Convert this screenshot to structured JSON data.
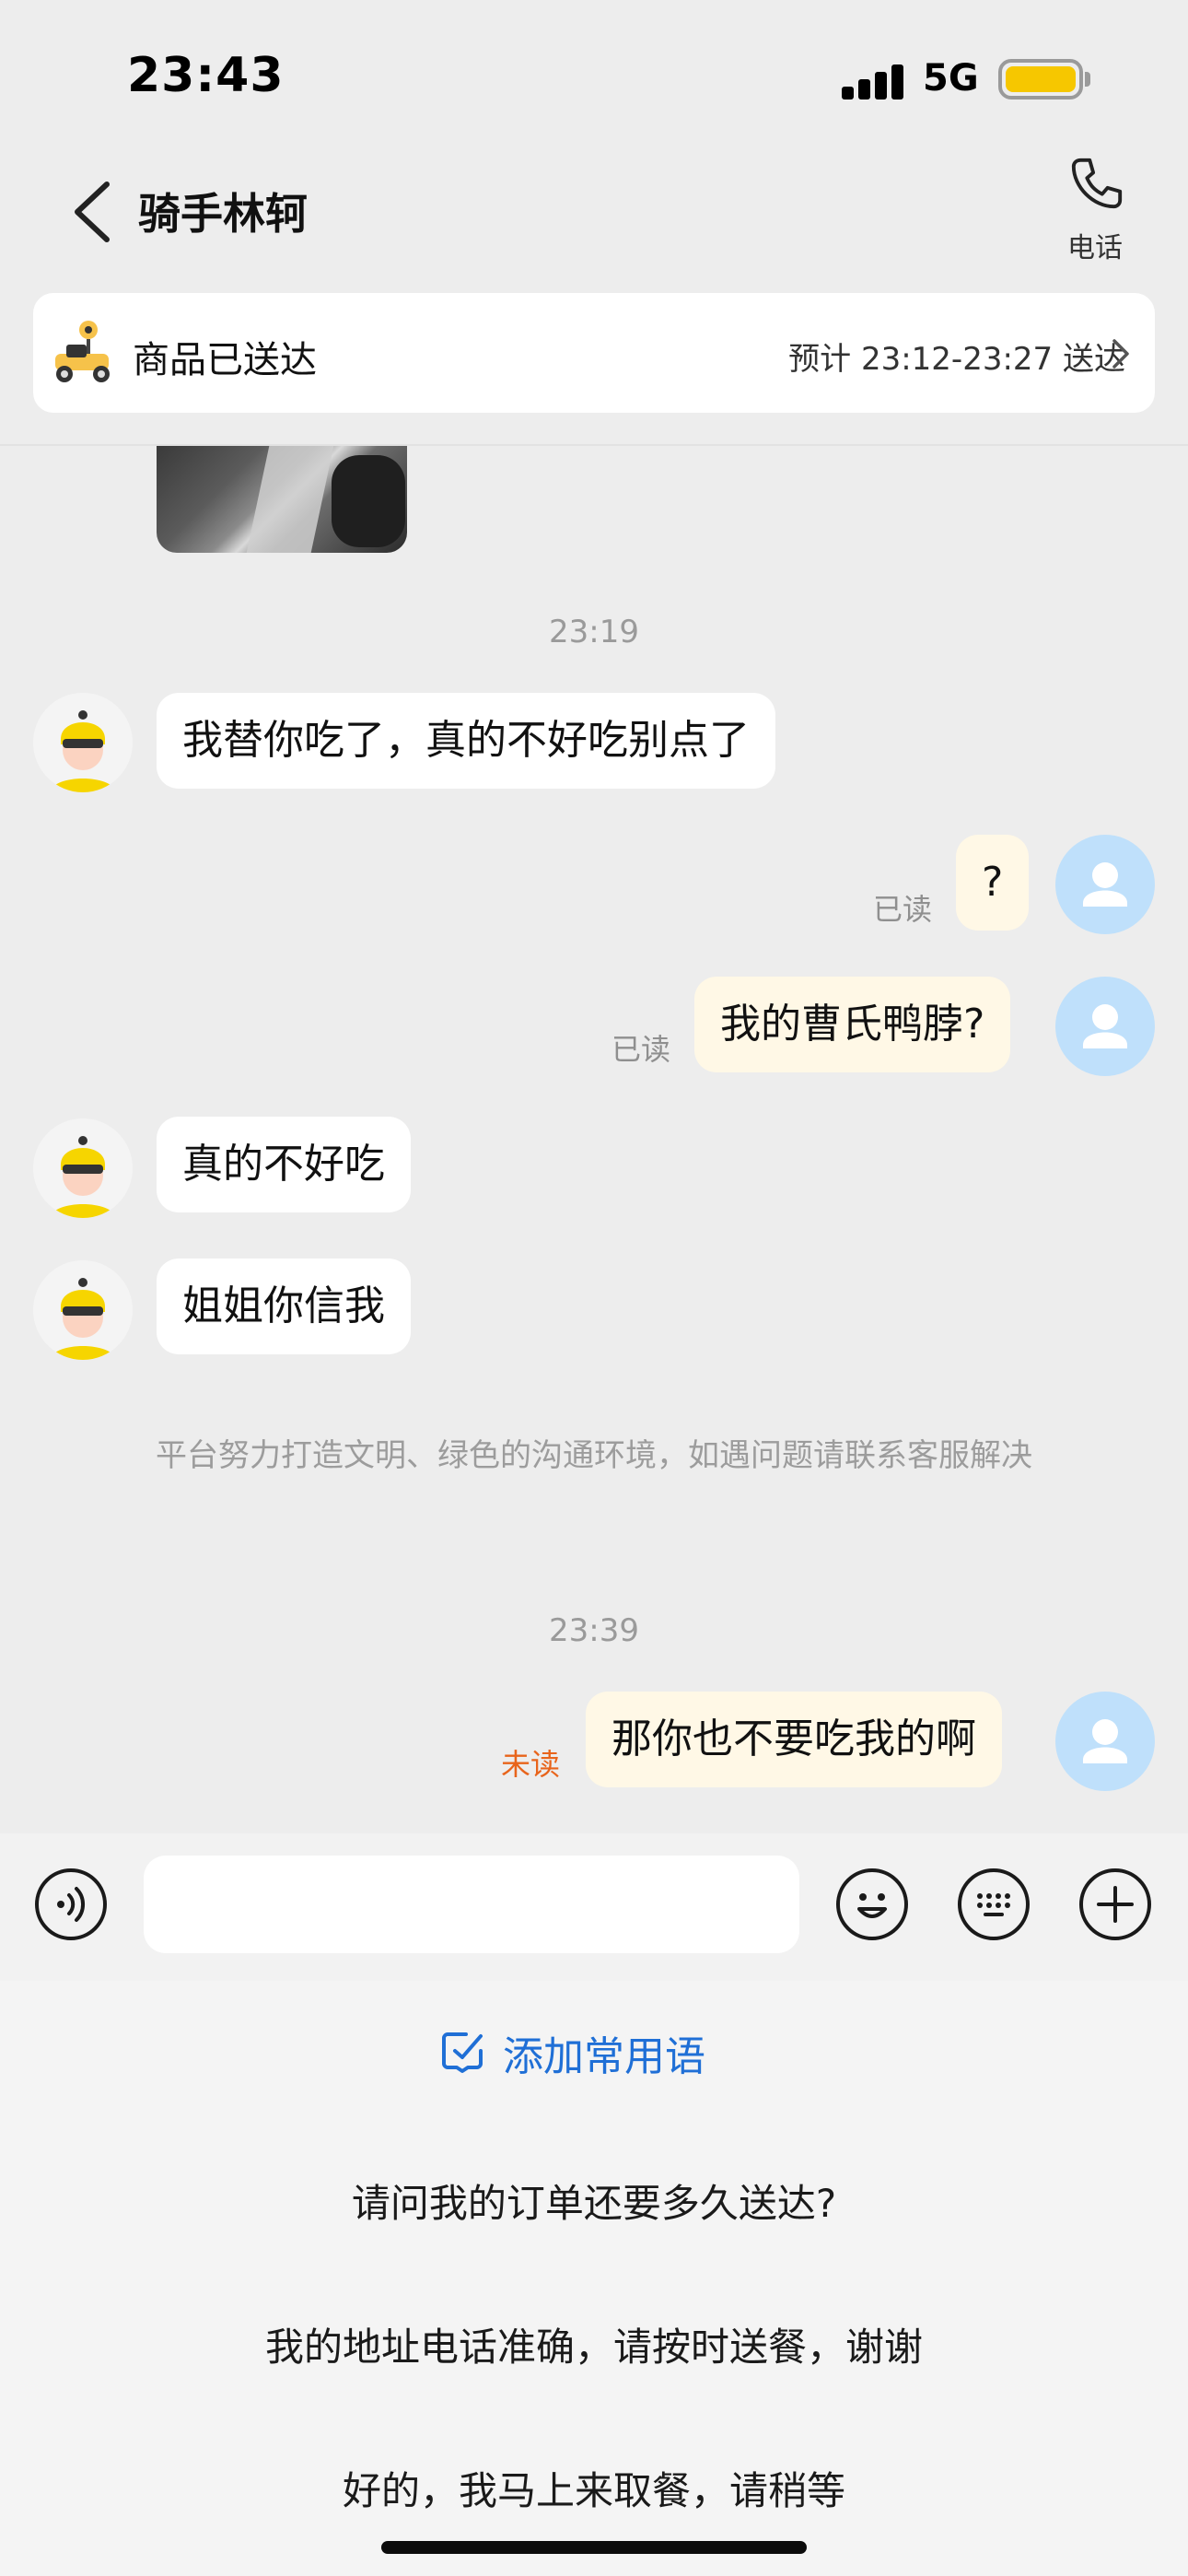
{
  "status_bar": {
    "time": "23:43",
    "network": "5G"
  },
  "header": {
    "back_icon": "chevron-left-icon",
    "title": "骑手林轲",
    "phone_label": "电话"
  },
  "order_card": {
    "status": "商品已送达",
    "eta": "预计 23:12-23:27 送达"
  },
  "chat": {
    "timestamp_1": "23:19",
    "msg_rider_1": "我替你吃了，真的不好吃别点了",
    "msg_user_1": "?",
    "read_1": "已读",
    "msg_user_2": "我的曹氏鸭脖?",
    "read_2": "已读",
    "msg_rider_2": "真的不好吃",
    "msg_rider_3": "姐姐你信我",
    "notice": "平台努力打造文明、绿色的沟通环境，如遇问题请联系客服解决",
    "timestamp_2": "23:39",
    "msg_user_3": "那你也不要吃我的啊",
    "unread_3": "未读"
  },
  "input": {
    "voice_icon": "voice-icon",
    "emoji_icon": "emoji-icon",
    "keyboard_icon": "keyboard-icon",
    "plus_icon": "plus-icon",
    "value": ""
  },
  "quick_replies": {
    "add_label": "添加常用语",
    "items": [
      "请问我的订单还要多久送达?",
      "我的地址电话准确，请按时送餐，谢谢",
      "好的，我马上来取餐，请稍等"
    ]
  },
  "colors": {
    "accent": "#1f6fd6",
    "unread": "#e8641b",
    "outgoing_bubble": "#fff8e6",
    "user_avatar": "#bfe0fb"
  }
}
